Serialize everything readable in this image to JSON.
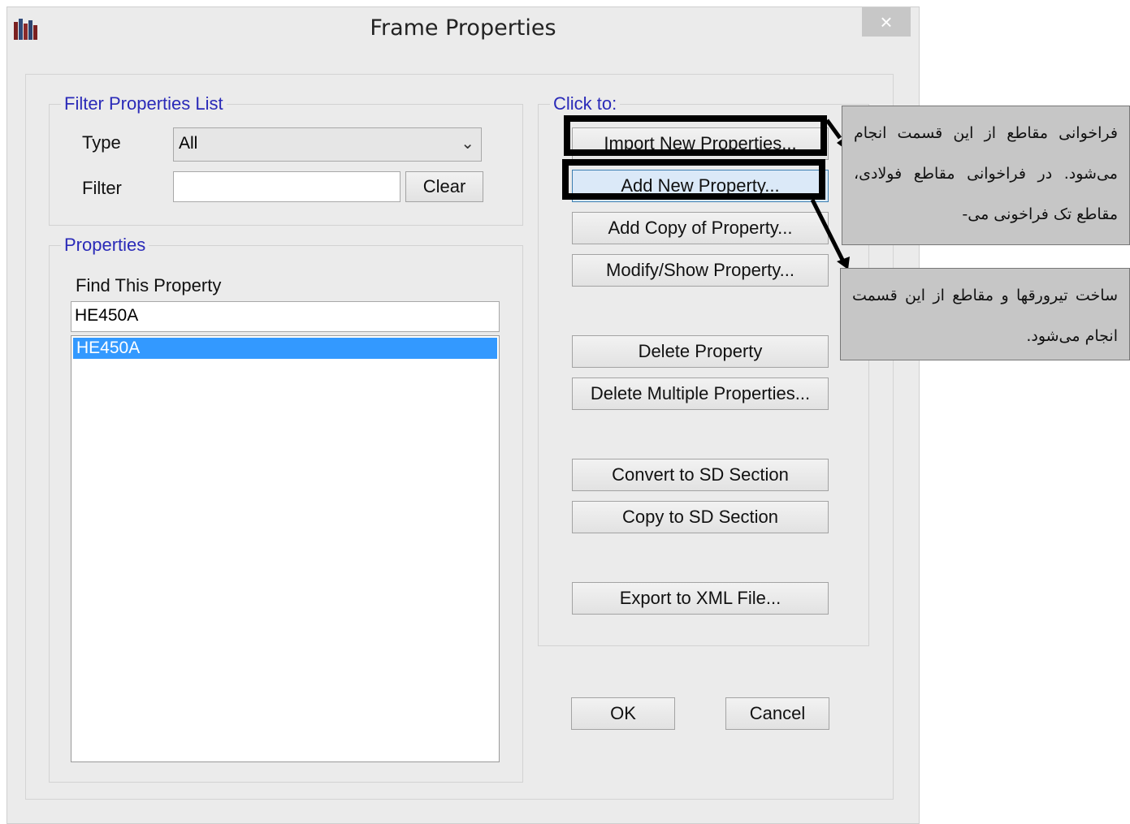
{
  "window": {
    "title": "Frame Properties",
    "close_label": "×"
  },
  "filter_group": {
    "title": "Filter Properties List",
    "type_label": "Type",
    "type_value": "All",
    "filter_label": "Filter",
    "filter_value": "",
    "clear_label": "Clear"
  },
  "properties_group": {
    "title": "Properties",
    "find_label": "Find This Property",
    "find_value": "HE450A",
    "list": [
      "HE450A"
    ]
  },
  "actions": {
    "title": "Click to:",
    "import": "Import New Properties...",
    "add_new": "Add New Property...",
    "add_copy": "Add Copy of Property...",
    "modify": "Modify/Show Property...",
    "delete": "Delete Property",
    "delete_multi": "Delete Multiple Properties...",
    "convert_sd": "Convert to SD Section",
    "copy_sd": "Copy to SD Section",
    "export_xml": "Export to XML File..."
  },
  "footer": {
    "ok": "OK",
    "cancel": "Cancel"
  },
  "annotations": {
    "callout_1": "فراخوانی مقاطع از این قسمت انجام می‌شود. در فراخوانی مقاطع فولادی، مقاطع تک فراخونی می-",
    "callout_2": "ساخت تیرورقها و مقاطع از این قسمت انجام می‌شود."
  },
  "colors": {
    "group_title": "#2a2ab8",
    "selection": "#3399ff",
    "window_bg": "#ebebeb",
    "callout_bg": "#c6c6c6"
  }
}
